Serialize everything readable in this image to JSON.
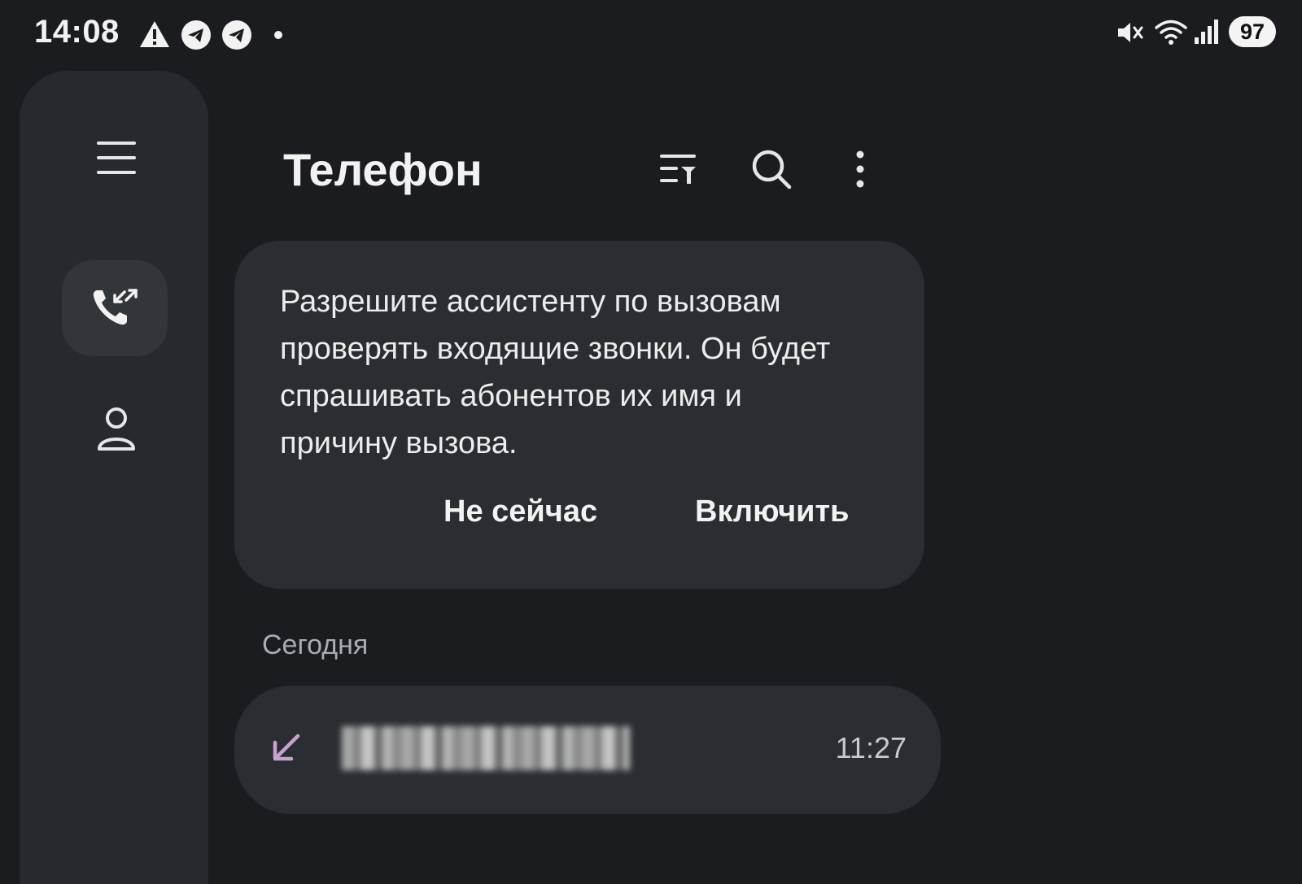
{
  "status_bar": {
    "time": "14:08",
    "battery": "97",
    "icons": [
      "warning-icon",
      "telegram-icon",
      "telegram-icon",
      "notification-dot-icon",
      "mute-icon",
      "wifi-icon",
      "signal-icon",
      "battery-icon"
    ]
  },
  "rail": {
    "items": [
      {
        "name": "menu",
        "icon": "hamburger-menu-icon"
      },
      {
        "name": "calls",
        "icon": "call-log-icon",
        "selected": true
      },
      {
        "name": "contacts",
        "icon": "person-icon"
      }
    ]
  },
  "app_bar": {
    "title": "Телефон",
    "actions": [
      "filter-icon",
      "search-icon",
      "more-vert-icon"
    ]
  },
  "banner": {
    "text": "Разрешите ассистенту по вызовам проверять входящие звонки. Он будет спрашивать абонентов их имя и причину вызова.",
    "dismiss_label": "Не сейчас",
    "confirm_label": "Включить"
  },
  "call_log": {
    "section_title": "Сегодня",
    "entries": [
      {
        "direction": "incoming",
        "number": "",
        "time": "11:27",
        "icon_color": "#c6a4cf"
      }
    ]
  },
  "colors": {
    "background": "#1a1c1f",
    "rail": "#26292d",
    "card": "#2a2d31",
    "incoming_accent": "#c6a4cf"
  }
}
